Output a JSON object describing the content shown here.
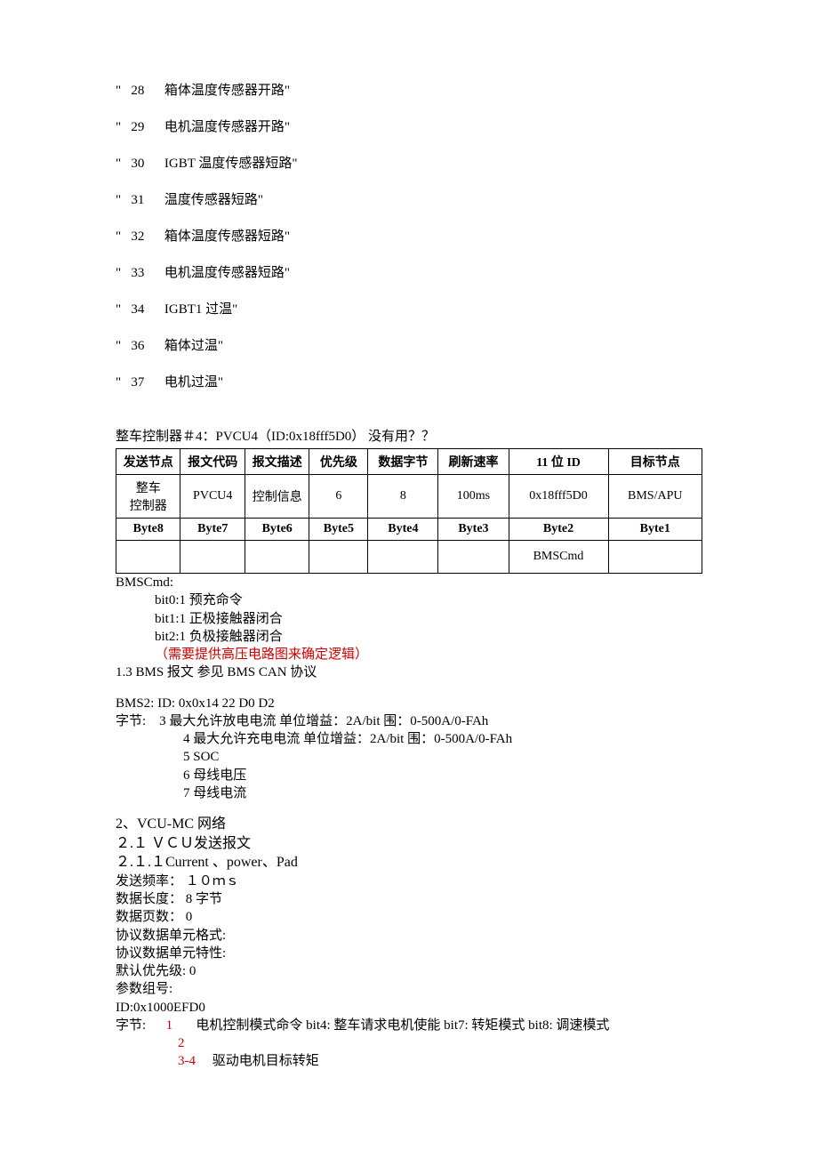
{
  "codeLines": [
    "\"   28      箱体温度传感器开路\"",
    "\"   29      电机温度传感器开路\"",
    "\"   30      IGBT 温度传感器短路\"",
    "\"   31      温度传感器短路\"",
    "\"   32      箱体温度传感器短路\"",
    "\"   33      电机温度传感器短路\"",
    "\"   34      IGBT1 过温\"",
    "\"   36      箱体过温\"",
    "\"   37      电机过温\""
  ],
  "pvcu4_title": "整车控制器＃4：PVCU4（ID:0x18fff5D0）  没有用？？",
  "table": {
    "headers": [
      "发送节点",
      "报文代码",
      "报文描述",
      "优先级",
      "数据字节",
      "刷新速率",
      "11 位 ID",
      "目标节点"
    ],
    "row1": [
      "整车\n控制器",
      "PVCU4",
      "控制信息",
      "6",
      "8",
      "100ms",
      "0x18fff5D0",
      "BMS/APU"
    ],
    "byteHeaders": [
      "Byte8",
      "Byte7",
      "Byte6",
      "Byte5",
      "Byte4",
      "Byte3",
      "Byte2",
      "Byte1"
    ],
    "row2": [
      "",
      "",
      "",
      "",
      "",
      "",
      "BMSCmd",
      ""
    ]
  },
  "bmscmd": {
    "title": "BMSCmd:",
    "b0": "bit0:1 预充命令",
    "b1": "bit1:1 正极接触器闭合",
    "b2": "bit2:1 负极接触器闭合",
    "note": "（需要提供高压电路图来确定逻辑）"
  },
  "s13": "1.3 BMS 报文    参见 BMS CAN 协议",
  "bms2": {
    "head": "BMS2:       ID:   0x0x14 22 D0 D2",
    "lead": "字节:",
    "l3": "3  最大允许放电电流    单位增益：2A/bit    围：0-500A/0-FAh",
    "l4": "4  最大允许充电电流    单位增益：2A/bit    围：0-500A/0-FAh",
    "l5": "5     SOC",
    "l6": "6     母线电压",
    "l7": "7     母线电流"
  },
  "s2": "2、VCU-MC 网络",
  "s21": "２.１    ＶＣＵ发送报文",
  "s211": "２.１.１Current  、power、Pad",
  "fields": {
    "freq": "发送频率：   １０ｍｓ",
    "len": "数据长度：             8 字节",
    "pages": "数据页数：             0",
    "fmt": "协议数据单元格式:",
    "chr": "协议数据单元特性:",
    "pri": "默认优先级:              0",
    "grp": "参数组号:",
    "id": "ID:0x1000EFD0"
  },
  "byteSection": {
    "lead": "字节:",
    "l1_num": "1",
    "l1_text": "电机控制模式命令    bit4:  整车请求电机使能  bit7:  转矩模式  bit8:  调速模式",
    "l2": "2",
    "l34_num": "3-4",
    "l34_text": "驱动电机目标转矩"
  }
}
